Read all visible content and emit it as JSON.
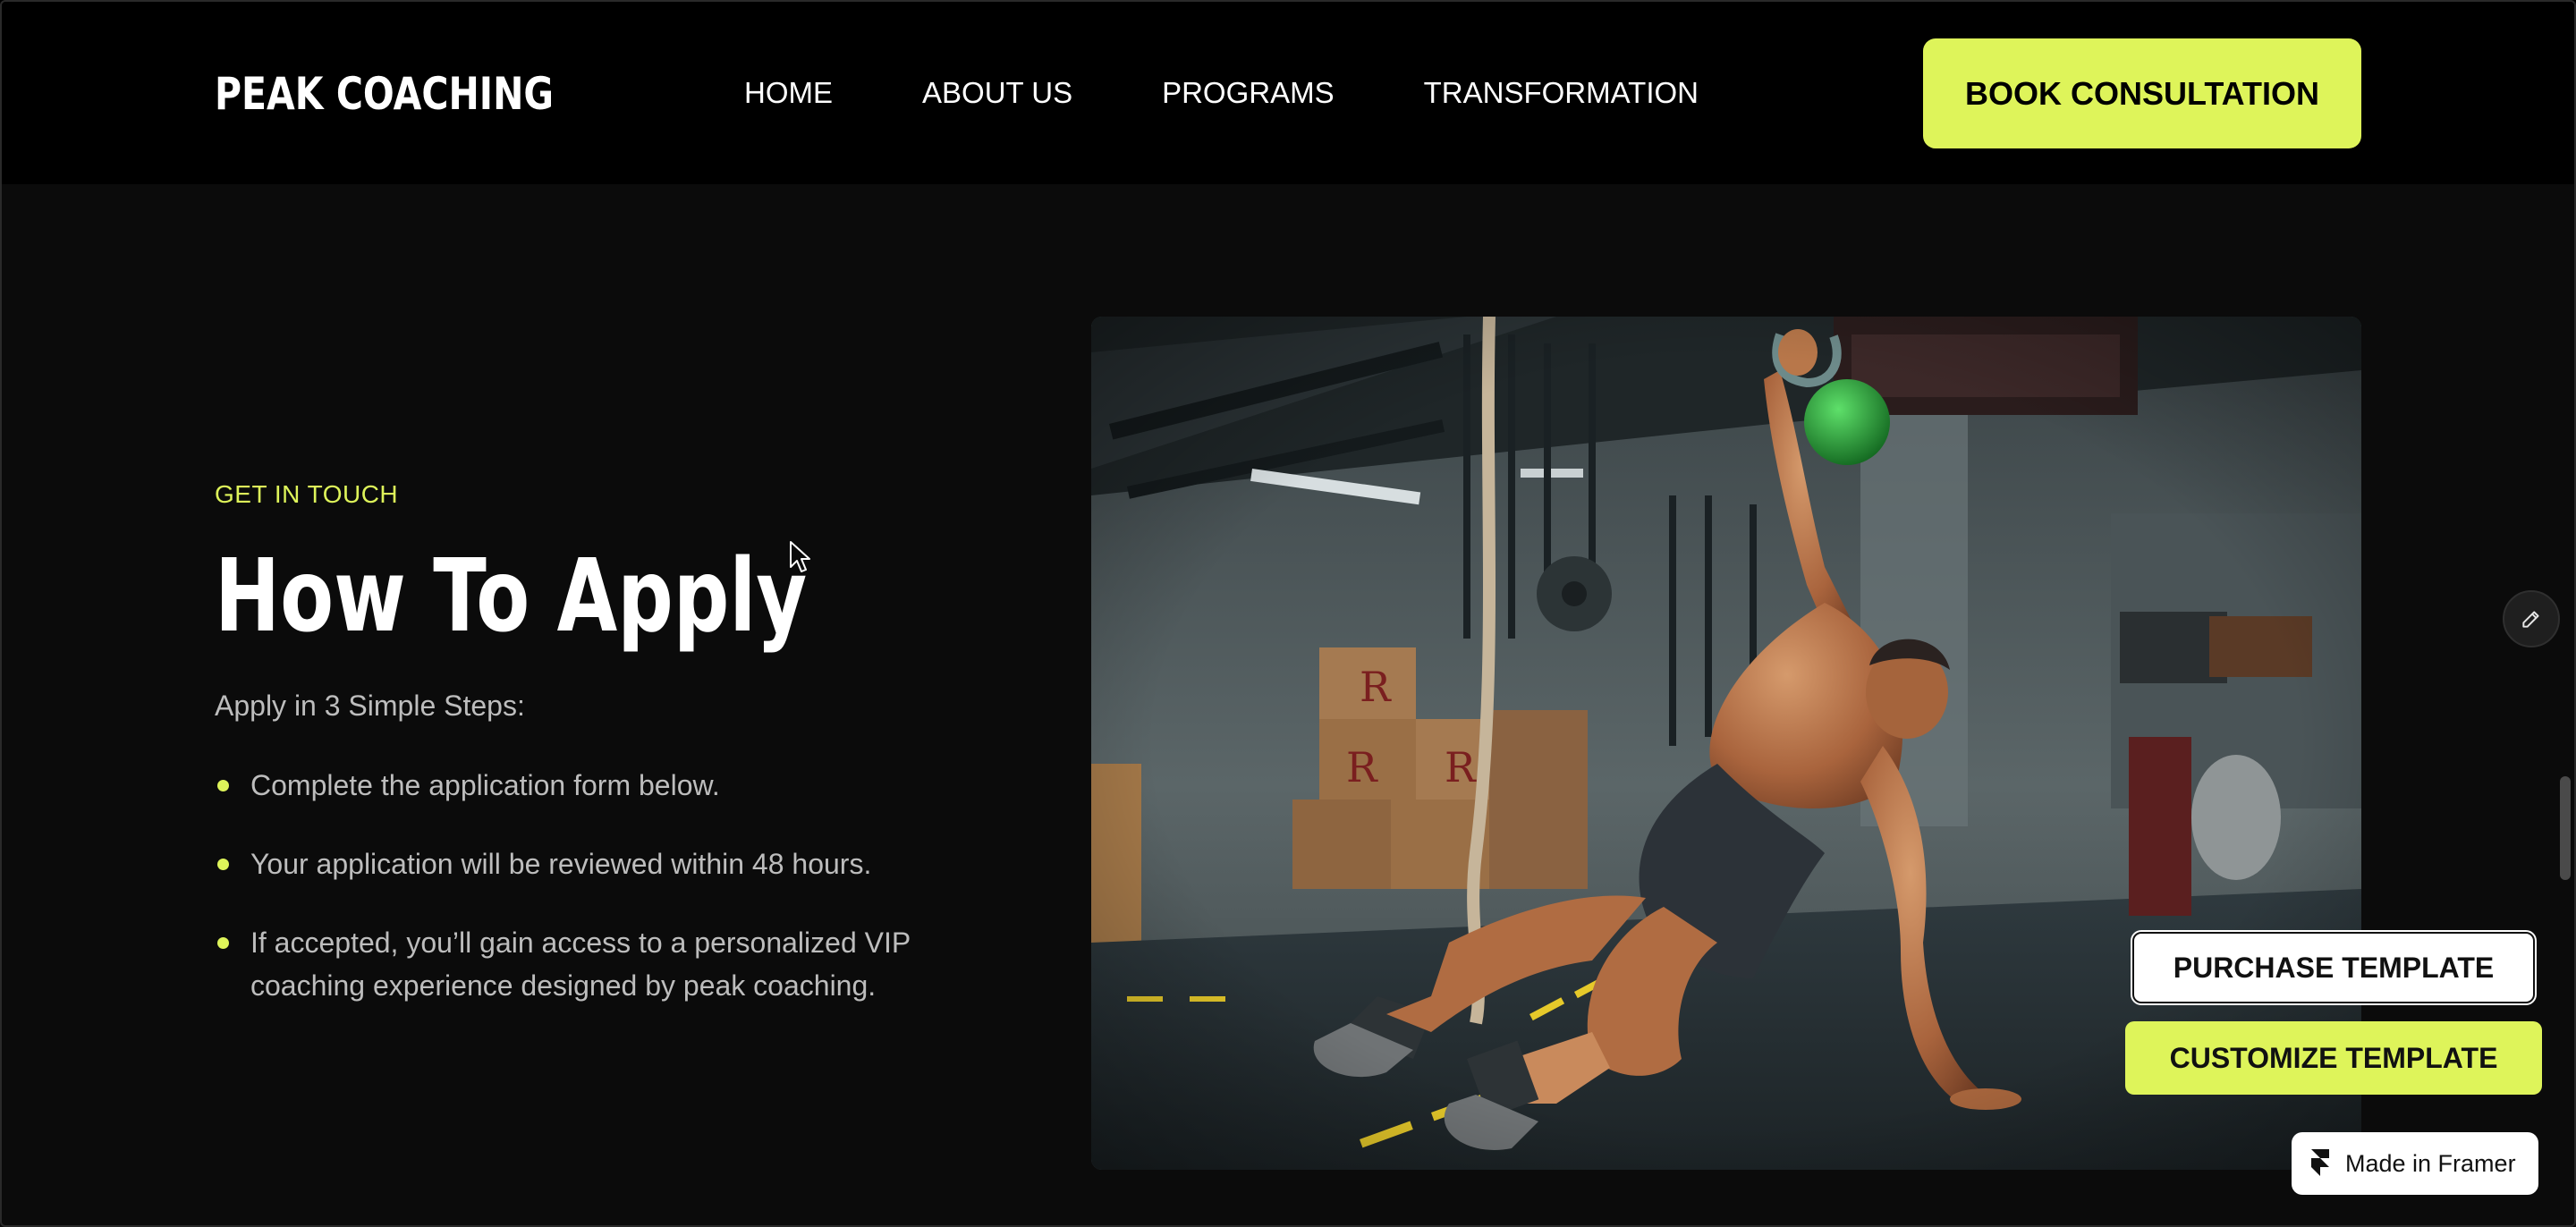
{
  "nav": {
    "logo": "PEAK COACHING",
    "links": [
      "HOME",
      "ABOUT US",
      "PROGRAMS",
      "TRANSFORMATION"
    ],
    "cta": "BOOK CONSULTATION"
  },
  "apply_section": {
    "eyebrow": "GET IN TOUCH",
    "title": "How To Apply",
    "intro": "Apply in 3 Simple Steps:",
    "steps": [
      "Complete the application form below.",
      "Your application will be reviewed within 48 hours.",
      "If accepted, you’ll gain access to a personalized VIP coaching experience designed by peak coaching."
    ]
  },
  "overlay": {
    "purchase_label": "PURCHASE TEMPLATE",
    "customize_label": "CUSTOMIZE TEMPLATE",
    "framer_badge": "Made in Framer"
  },
  "icons": {
    "edit": "pencil-icon",
    "framer": "framer-logo-icon",
    "cursor": "mouse-pointer-icon"
  },
  "colors": {
    "accent": "#def45a",
    "background": "#0b0b0b",
    "nav_background": "#000000",
    "body_text": "#bdbdbd"
  }
}
